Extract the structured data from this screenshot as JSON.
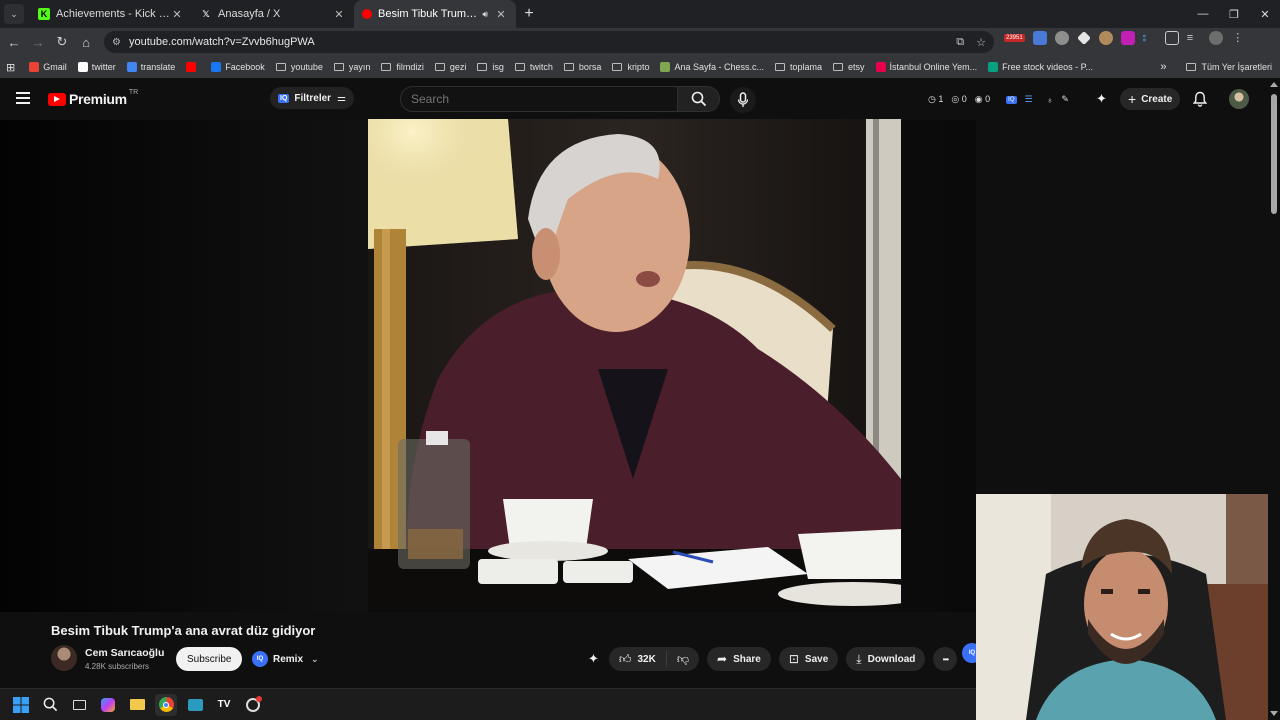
{
  "browser": {
    "tabs": [
      {
        "title": "Achievements - Kick Dashboard",
        "favicon_color": "#53fc18",
        "favicon_glyph": "K",
        "active": false
      },
      {
        "title": "Anasayfa / X",
        "favicon_color": "#000000",
        "favicon_glyph": "X",
        "active": false
      },
      {
        "title": "Besim Tibuk Trump'a ana avrat düz gidiyor - YouTube",
        "favicon_color": "#ff0000",
        "favicon_glyph": "▶",
        "active": true
      }
    ],
    "new_tab": "+",
    "url": "youtube.com/watch?v=Zvvb6hugPWA",
    "extension_badge": "23951"
  },
  "bookmarks": {
    "items": [
      {
        "label": "Gmail",
        "icon": "gmail-icon",
        "type": "site",
        "color": "#ea4335"
      },
      {
        "label": "twitter",
        "icon": "x-icon",
        "type": "site",
        "color": "#ffffff"
      },
      {
        "label": "translate",
        "icon": "translate-icon",
        "type": "site",
        "color": "#4285f4"
      },
      {
        "label": "",
        "icon": "youtube-icon",
        "type": "site",
        "color": "#ff0000"
      },
      {
        "label": "Facebook",
        "icon": "facebook-icon",
        "type": "site",
        "color": "#1877f2"
      },
      {
        "label": "youtube",
        "icon": "folder-icon",
        "type": "folder"
      },
      {
        "label": "yayın",
        "icon": "folder-icon",
        "type": "folder"
      },
      {
        "label": "filmdizi",
        "icon": "folder-icon",
        "type": "folder"
      },
      {
        "label": "gezi",
        "icon": "folder-icon",
        "type": "folder"
      },
      {
        "label": "isg",
        "icon": "folder-icon",
        "type": "folder"
      },
      {
        "label": "twitch",
        "icon": "folder-icon",
        "type": "folder"
      },
      {
        "label": "borsa",
        "icon": "folder-icon",
        "type": "folder"
      },
      {
        "label": "kripto",
        "icon": "folder-icon",
        "type": "folder"
      },
      {
        "label": "Ana Sayfa - Chess.c...",
        "icon": "chess-icon",
        "type": "site",
        "color": "#7fa650"
      },
      {
        "label": "toplama",
        "icon": "folder-icon",
        "type": "folder"
      },
      {
        "label": "etsy",
        "icon": "folder-icon",
        "type": "folder"
      },
      {
        "label": "İstanbul Online Yem...",
        "icon": "yemek-icon",
        "type": "site",
        "color": "#ea004b"
      },
      {
        "label": "Free stock videos - P...",
        "icon": "pexels-icon",
        "type": "site",
        "color": "#07a081"
      }
    ],
    "overflow": "»",
    "all_bookmarks": "Tüm Yer İşaretleri"
  },
  "youtube": {
    "logo_text": "Premium",
    "country_code": "TR",
    "filter_label": "Filtreler",
    "filter_badge": "IQ",
    "search_placeholder": "Search",
    "stats": {
      "clock": "1",
      "views": "0",
      "eye2": "0"
    },
    "create_label": "Create"
  },
  "video": {
    "title": "Besim Tibuk Trump'a ana avrat düz gidiyor",
    "channel": "Cem Sarıcaoğlu",
    "subscribers": "4.28K subscribers",
    "subscribe_label": "Subscribe",
    "remix_label": "Remix",
    "remix_badge": "IQ",
    "likes": "32K",
    "share_label": "Share",
    "save_label": "Save",
    "download_label": "Download",
    "more_label": "•••"
  },
  "colors": {
    "accent": "#ff0000",
    "iq_blue": "#3a6ff7",
    "bg": "#0f0f0f"
  }
}
